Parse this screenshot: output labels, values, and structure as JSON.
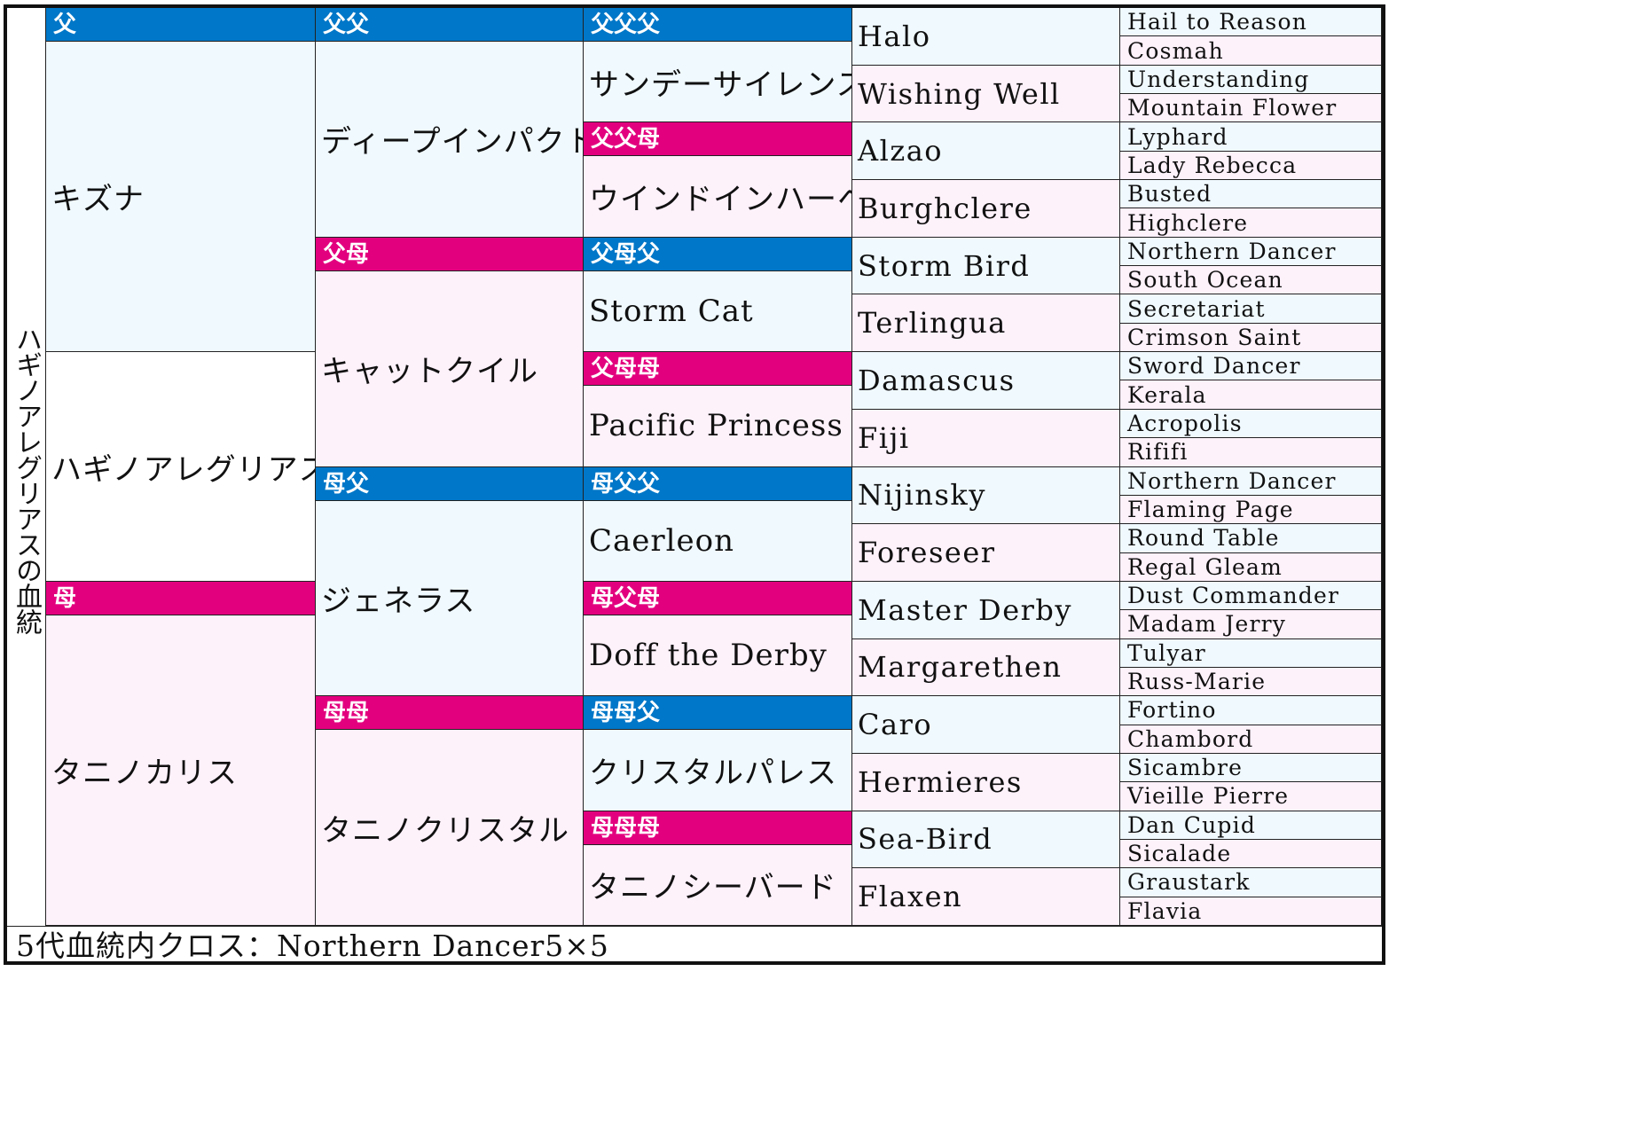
{
  "title": "ハギノアレグリアスの血統",
  "colors": {
    "male_header": "#0077c8",
    "female_header": "#e3007f",
    "male_bg": "#f0f9fe",
    "female_bg": "#fdf1fa"
  },
  "subject": "ハギノアレグリアス",
  "gen1": [
    {
      "label": "父",
      "name": "キズナ",
      "sex": "male"
    },
    {
      "label": "母",
      "name": "タニノカリス",
      "sex": "female"
    }
  ],
  "gen2": [
    {
      "label": "父父",
      "name": "ディープインパクト",
      "sex": "male"
    },
    {
      "label": "父母",
      "name": "キャットクイル",
      "sex": "female"
    },
    {
      "label": "母父",
      "name": "ジェネラス",
      "sex": "male"
    },
    {
      "label": "母母",
      "name": "タニノクリスタル",
      "sex": "female"
    }
  ],
  "gen3": [
    {
      "label": "父父父",
      "name": "サンデーサイレンス",
      "sex": "male"
    },
    {
      "label": "父父母",
      "name": "ウインドインハーヘア",
      "sex": "female"
    },
    {
      "label": "父母父",
      "name": "Storm Cat",
      "sex": "male"
    },
    {
      "label": "父母母",
      "name": "Pacific Princess",
      "sex": "female"
    },
    {
      "label": "母父父",
      "name": "Caerleon",
      "sex": "male"
    },
    {
      "label": "母父母",
      "name": "Doff the Derby",
      "sex": "female"
    },
    {
      "label": "母母父",
      "name": "クリスタルパレス",
      "sex": "male"
    },
    {
      "label": "母母母",
      "name": "タニノシーバード",
      "sex": "female"
    }
  ],
  "gen4": [
    "Halo",
    "Wishing Well",
    "Alzao",
    "Burghclere",
    "Storm Bird",
    "Terlingua",
    "Damascus",
    "Fiji",
    "Nijinsky",
    "Foreseer",
    "Master Derby",
    "Margarethen",
    "Caro",
    "Hermieres",
    "Sea-Bird",
    "Flaxen"
  ],
  "gen5": [
    "Hail to Reason",
    "Cosmah",
    "Understanding",
    "Mountain Flower",
    "Lyphard",
    "Lady Rebecca",
    "Busted",
    "Highclere",
    "Northern Dancer",
    "South Ocean",
    "Secretariat",
    "Crimson Saint",
    "Sword Dancer",
    "Kerala",
    "Acropolis",
    "Rififi",
    "Northern Dancer",
    "Flaming Page",
    "Round Table",
    "Regal Gleam",
    "Dust Commander",
    "Madam Jerry",
    "Tulyar",
    "Russ-Marie",
    "Fortino",
    "Chambord",
    "Sicambre",
    "Vieille Pierre",
    "Dan Cupid",
    "Sicalade",
    "Graustark",
    "Flavia"
  ],
  "subject_cell": "ハギノアレグリアス",
  "footer": "5代血統内クロス：Northern Dancer5×5"
}
